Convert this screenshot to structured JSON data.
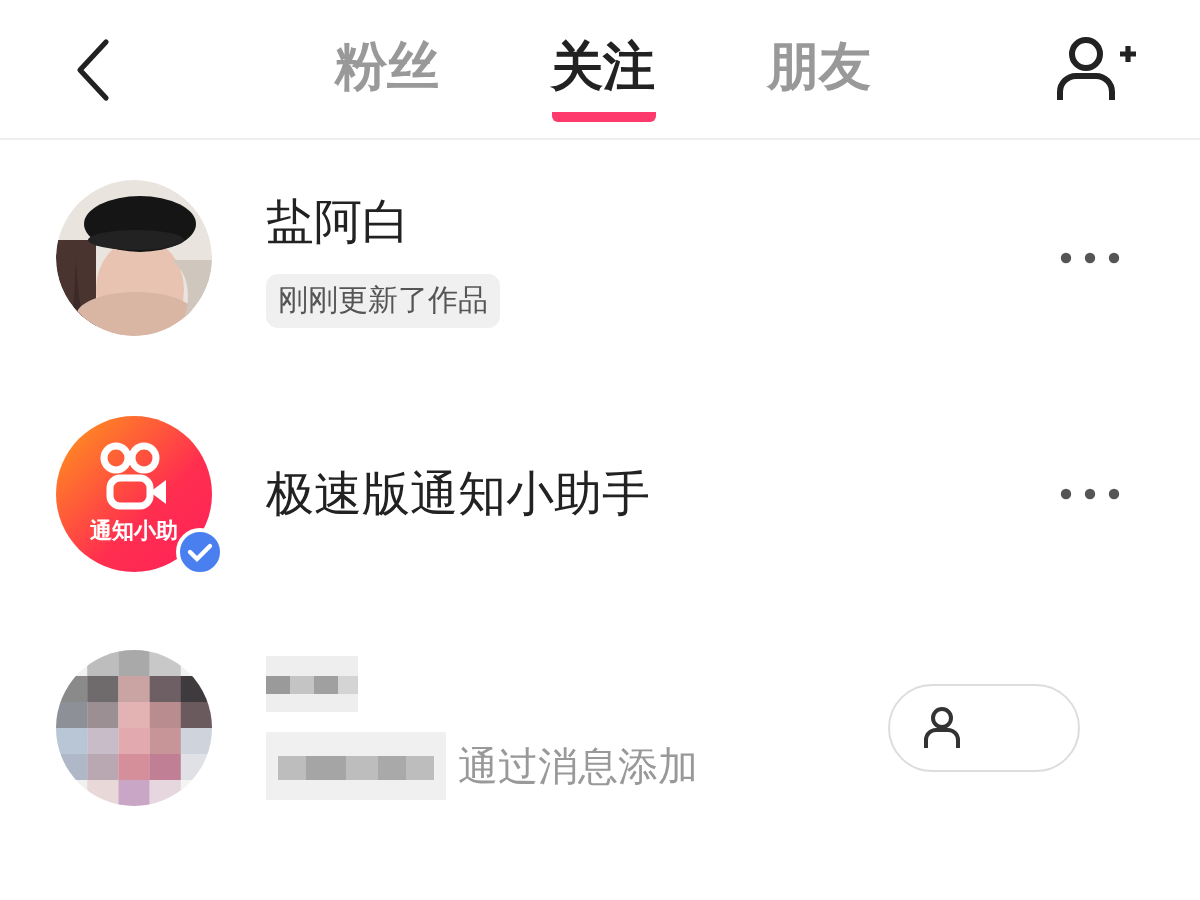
{
  "tabs": [
    {
      "label": "粉丝",
      "selected": false
    },
    {
      "label": "关注",
      "selected": true
    },
    {
      "label": "朋友",
      "selected": false
    }
  ],
  "users": [
    {
      "kind": "person",
      "name": "盐阿白",
      "tag": "刚刚更新了作品",
      "verified": false
    },
    {
      "kind": "official",
      "name": "极速版通知小助手",
      "avatar_label": "通知小助",
      "verified": true
    },
    {
      "kind": "masked",
      "note": "通过消息添加",
      "verified": false
    }
  ]
}
